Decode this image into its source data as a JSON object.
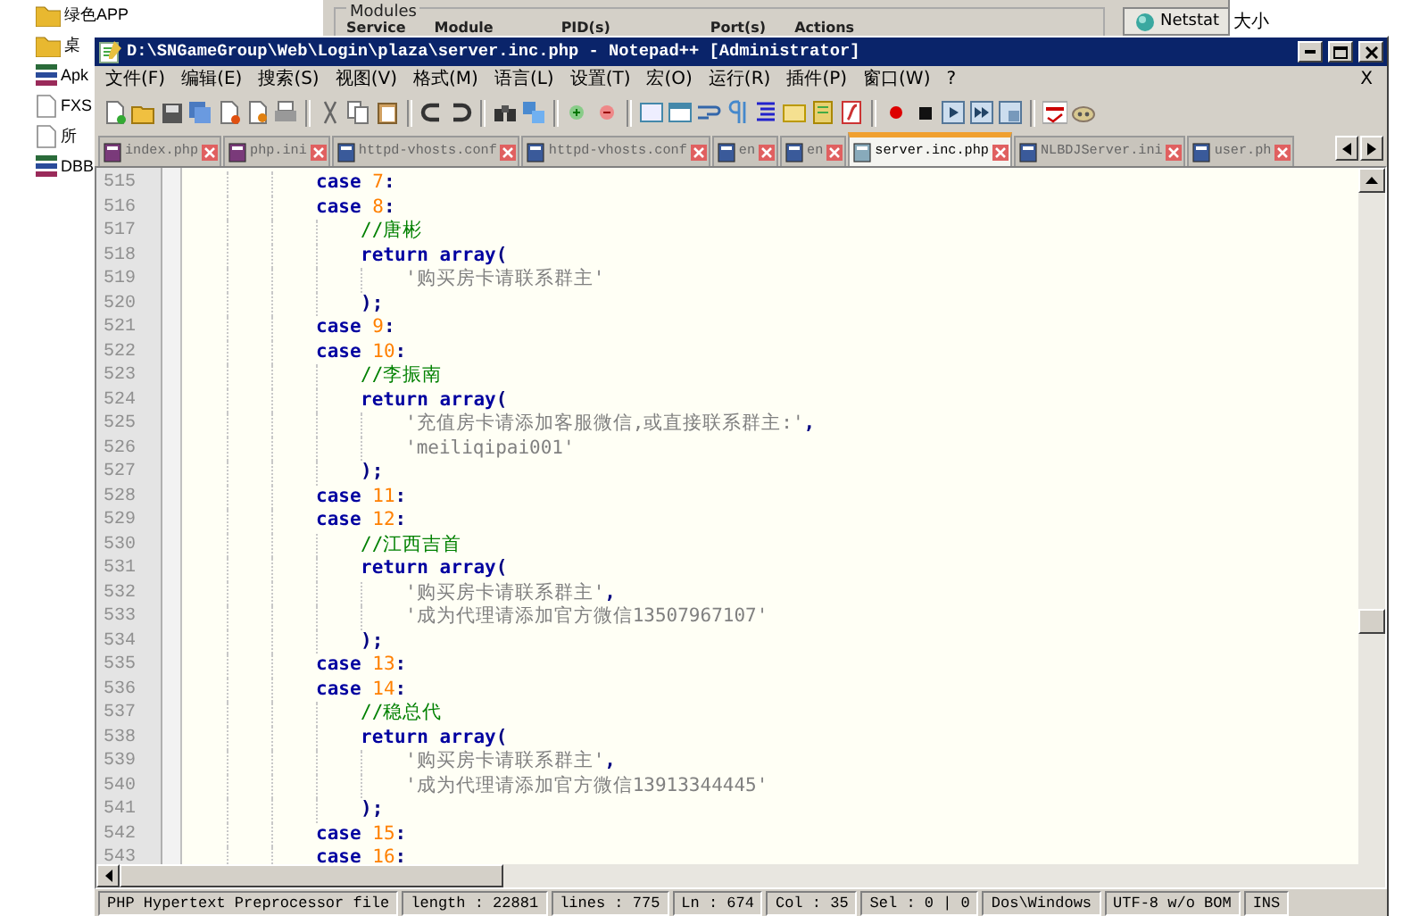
{
  "desktop": {
    "explorer_items": [
      {
        "kind": "folder",
        "label": "绿色APP"
      },
      {
        "kind": "folder",
        "label": "桌"
      },
      {
        "kind": "archive",
        "label": "Apk"
      },
      {
        "kind": "file",
        "label": "FXS"
      },
      {
        "kind": "file",
        "label": "所"
      },
      {
        "kind": "archive",
        "label": "DBB"
      }
    ],
    "background_window": {
      "group_title": "Modules",
      "columns": [
        "Service",
        "Module",
        "PID(s)",
        "Port(s)",
        "Actions"
      ],
      "button": "Netstat",
      "side_header": "大小"
    }
  },
  "window": {
    "title": "D:\\SNGameGroup\\Web\\Login\\plaza\\server.inc.php - Notepad++ [Administrator]",
    "menu": [
      "文件(F)",
      "编辑(E)",
      "搜索(S)",
      "视图(V)",
      "格式(M)",
      "语言(L)",
      "设置(T)",
      "宏(O)",
      "运行(R)",
      "插件(P)",
      "窗口(W)",
      "?"
    ],
    "menu_close": "X",
    "tabs": [
      {
        "label": "index.php",
        "kind": "php",
        "selected": false
      },
      {
        "label": "php.ini",
        "kind": "php",
        "selected": false
      },
      {
        "label": "httpd-vhosts.conf",
        "kind": "text",
        "selected": false
      },
      {
        "label": "httpd-vhosts.conf",
        "kind": "text",
        "selected": false
      },
      {
        "label": "en",
        "kind": "text",
        "selected": false
      },
      {
        "label": "en",
        "kind": "text",
        "selected": false
      },
      {
        "label": "server.inc.php",
        "kind": "text",
        "selected": true
      },
      {
        "label": "NLBDJServer.ini",
        "kind": "text",
        "selected": false
      },
      {
        "label": "user.ph",
        "kind": "text",
        "selected": false
      }
    ]
  },
  "editor": {
    "lines": [
      {
        "number": "515",
        "kind": "case",
        "tokens": [
          {
            "kind": "keyword",
            "text": "case"
          },
          {
            "kind": "number",
            "text": " 7"
          },
          {
            "kind": "operator",
            "text": ":"
          }
        ]
      },
      {
        "number": "516",
        "kind": "case",
        "tokens": [
          {
            "kind": "keyword",
            "text": "case"
          },
          {
            "kind": "number",
            "text": " 8"
          },
          {
            "kind": "operator",
            "text": ":"
          }
        ]
      },
      {
        "number": "517",
        "kind": "comment",
        "tokens": [
          {
            "kind": "comment",
            "text": "//唐彬"
          }
        ]
      },
      {
        "number": "518",
        "kind": "return",
        "tokens": [
          {
            "kind": "keyword",
            "text": "return array"
          },
          {
            "kind": "operator",
            "text": "("
          }
        ]
      },
      {
        "number": "519",
        "kind": "item",
        "tokens": [
          {
            "kind": "string",
            "text": "'购买房卡请联系群主'"
          }
        ]
      },
      {
        "number": "520",
        "kind": "close",
        "tokens": [
          {
            "kind": "operator",
            "text": ");"
          }
        ]
      },
      {
        "number": "521",
        "kind": "case",
        "tokens": [
          {
            "kind": "keyword",
            "text": "case"
          },
          {
            "kind": "number",
            "text": " 9"
          },
          {
            "kind": "operator",
            "text": ":"
          }
        ]
      },
      {
        "number": "522",
        "kind": "case",
        "tokens": [
          {
            "kind": "keyword",
            "text": "case"
          },
          {
            "kind": "number",
            "text": " 10"
          },
          {
            "kind": "operator",
            "text": ":"
          }
        ]
      },
      {
        "number": "523",
        "kind": "comment",
        "tokens": [
          {
            "kind": "comment",
            "text": "//李振南"
          }
        ]
      },
      {
        "number": "524",
        "kind": "return",
        "tokens": [
          {
            "kind": "keyword",
            "text": "return array"
          },
          {
            "kind": "operator",
            "text": "("
          }
        ]
      },
      {
        "number": "525",
        "kind": "item",
        "tokens": [
          {
            "kind": "string",
            "text": "'充值房卡请添加客服微信,或直接联系群主:'"
          },
          {
            "kind": "operator",
            "text": ","
          }
        ]
      },
      {
        "number": "526",
        "kind": "item",
        "tokens": [
          {
            "kind": "string",
            "text": "'meiliqipai001'"
          }
        ]
      },
      {
        "number": "527",
        "kind": "close",
        "tokens": [
          {
            "kind": "operator",
            "text": ");"
          }
        ]
      },
      {
        "number": "528",
        "kind": "case",
        "tokens": [
          {
            "kind": "keyword",
            "text": "case"
          },
          {
            "kind": "number",
            "text": " 11"
          },
          {
            "kind": "operator",
            "text": ":"
          }
        ]
      },
      {
        "number": "529",
        "kind": "case",
        "tokens": [
          {
            "kind": "keyword",
            "text": "case"
          },
          {
            "kind": "number",
            "text": " 12"
          },
          {
            "kind": "operator",
            "text": ":"
          }
        ]
      },
      {
        "number": "530",
        "kind": "comment",
        "tokens": [
          {
            "kind": "comment",
            "text": "//江西吉首"
          }
        ]
      },
      {
        "number": "531",
        "kind": "return",
        "tokens": [
          {
            "kind": "keyword",
            "text": "return array"
          },
          {
            "kind": "operator",
            "text": "("
          }
        ]
      },
      {
        "number": "532",
        "kind": "item",
        "tokens": [
          {
            "kind": "string",
            "text": "'购买房卡请联系群主'"
          },
          {
            "kind": "operator",
            "text": ","
          }
        ]
      },
      {
        "number": "533",
        "kind": "item",
        "tokens": [
          {
            "kind": "string",
            "text": "'成为代理请添加官方微信13507967107'"
          }
        ]
      },
      {
        "number": "534",
        "kind": "close",
        "tokens": [
          {
            "kind": "operator",
            "text": ");"
          }
        ]
      },
      {
        "number": "535",
        "kind": "case",
        "tokens": [
          {
            "kind": "keyword",
            "text": "case"
          },
          {
            "kind": "number",
            "text": " 13"
          },
          {
            "kind": "operator",
            "text": ":"
          }
        ]
      },
      {
        "number": "536",
        "kind": "case",
        "tokens": [
          {
            "kind": "keyword",
            "text": "case"
          },
          {
            "kind": "number",
            "text": " 14"
          },
          {
            "kind": "operator",
            "text": ":"
          }
        ]
      },
      {
        "number": "537",
        "kind": "comment",
        "tokens": [
          {
            "kind": "comment",
            "text": "//稳总代"
          }
        ]
      },
      {
        "number": "538",
        "kind": "return",
        "tokens": [
          {
            "kind": "keyword",
            "text": "return array"
          },
          {
            "kind": "operator",
            "text": "("
          }
        ]
      },
      {
        "number": "539",
        "kind": "item",
        "tokens": [
          {
            "kind": "string",
            "text": "'购买房卡请联系群主'"
          },
          {
            "kind": "operator",
            "text": ","
          }
        ]
      },
      {
        "number": "540",
        "kind": "item",
        "tokens": [
          {
            "kind": "string",
            "text": "'成为代理请添加官方微信13913344445'"
          }
        ]
      },
      {
        "number": "541",
        "kind": "close",
        "tokens": [
          {
            "kind": "operator",
            "text": ");"
          }
        ]
      },
      {
        "number": "542",
        "kind": "case",
        "tokens": [
          {
            "kind": "keyword",
            "text": "case"
          },
          {
            "kind": "number",
            "text": " 15"
          },
          {
            "kind": "operator",
            "text": ":"
          }
        ]
      },
      {
        "number": "543",
        "kind": "case",
        "tokens": [
          {
            "kind": "keyword",
            "text": "case"
          },
          {
            "kind": "number",
            "text": " 16"
          },
          {
            "kind": "operator",
            "text": ":"
          }
        ]
      }
    ]
  },
  "status_bar": [
    "PHP Hypertext Preprocessor file",
    "length : 22881",
    "lines : 775",
    "Ln : 674",
    "Col : 35",
    "Sel : 0 | 0",
    "Dos\\Windows",
    "UTF-8 w/o BOM",
    "INS"
  ]
}
